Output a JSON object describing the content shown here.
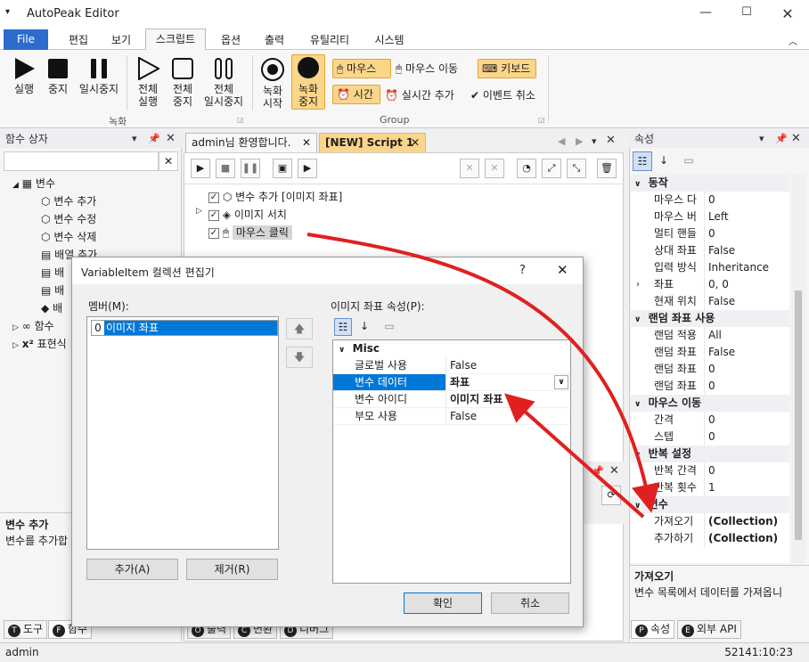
{
  "window": {
    "icon": "menu-arrow-icon",
    "title": "AutoPeak Editor"
  },
  "menu": {
    "file": "File",
    "tabs": [
      "편집",
      "보기",
      "스크립트",
      "옵션",
      "출력",
      "유틸리티",
      "시스템"
    ]
  },
  "ribbon": {
    "record_buttons": [
      "실행",
      "중지",
      "일시중지"
    ],
    "all_buttons": [
      [
        "전체",
        "실행"
      ],
      [
        "전체",
        "중지"
      ],
      [
        "전체",
        "일시중지"
      ]
    ],
    "record_group": "녹화",
    "rec_buttons": [
      [
        "녹화",
        "시작"
      ],
      [
        "녹화",
        "중지"
      ]
    ],
    "group_items": [
      "마우스",
      "마우스 이동",
      "키보드",
      "시간",
      "실시간 추가",
      "이벤트 취소"
    ],
    "group_label": "Group"
  },
  "left_panel": {
    "title": "함수 상자",
    "tree_root": "변수",
    "tree_items": [
      "변수 추가",
      "변수 수정",
      "변수 삭제",
      "배열 추가",
      "배",
      "배",
      "배"
    ],
    "func": "함수",
    "expr": "표현식",
    "desc_title": "변수 추가",
    "desc_text": "변수를 추가합",
    "tabs": [
      "도구",
      "함수"
    ]
  },
  "editor": {
    "tabs": [
      "admin님 환영합니다.",
      "[NEW] Script 1"
    ],
    "lines": [
      "변수 추가 [이미지 좌표]",
      "이미지 서치",
      "마우스 클릭"
    ],
    "bottom_tabs": [
      "출력",
      "변환",
      "디버그"
    ]
  },
  "props": {
    "title": "속성",
    "groups": [
      {
        "name": "동작",
        "rows": [
          [
            "마우스 다",
            "0"
          ],
          [
            "마우스 버",
            "Left"
          ],
          [
            "멀티 핸들",
            "0"
          ],
          [
            "상대 좌표",
            "False"
          ],
          [
            "입력 방식",
            "Inheritance"
          ],
          [
            "좌표",
            "0, 0"
          ],
          [
            "현재 위치",
            "False"
          ]
        ]
      },
      {
        "name": "랜덤 좌표 사용",
        "rows": [
          [
            "랜덤 적용",
            "All"
          ],
          [
            "랜덤 좌표",
            "False"
          ],
          [
            "랜덤 좌표",
            "0"
          ],
          [
            "랜덤 좌표",
            "0"
          ]
        ]
      },
      {
        "name": "마우스 이동",
        "rows": [
          [
            "간격",
            "0"
          ],
          [
            "스텝",
            "0"
          ]
        ]
      },
      {
        "name": "반복 설정",
        "rows": [
          [
            "반복 간격",
            "0"
          ],
          [
            "반복 횟수",
            "1"
          ]
        ]
      },
      {
        "name": "변수",
        "rows": [
          [
            "가져오기",
            "(Collection)"
          ],
          [
            "추가하기",
            "(Collection)"
          ]
        ]
      }
    ],
    "desc_title": "가져오기",
    "desc_text": "변수 목록에서 데이터를 가져옵니",
    "tabs": [
      "속성",
      "외부 API"
    ]
  },
  "dialog": {
    "title": "VariableItem 컬렉션 편집기",
    "help": "?",
    "members_label": "멤버(M):",
    "member_index": "0",
    "member_item": "이미지 좌표",
    "props_label": "이미지 좌표 속성(P):",
    "grid_group": "Misc",
    "grid_rows": [
      [
        "글로벌 사용",
        "False"
      ],
      [
        "변수 데이터",
        "좌표"
      ],
      [
        "변수 아이디",
        "이미지 좌표"
      ],
      [
        "부모 사용",
        "False"
      ]
    ],
    "add": "추가(A)",
    "remove": "제거(R)",
    "ok": "확인",
    "cancel": "취소"
  },
  "status": {
    "user": "admin",
    "time": "52141:10:23"
  },
  "colors": {
    "accent": "#2b6ccc",
    "arrow": "#e02020",
    "highlight": "#fbd58a"
  }
}
